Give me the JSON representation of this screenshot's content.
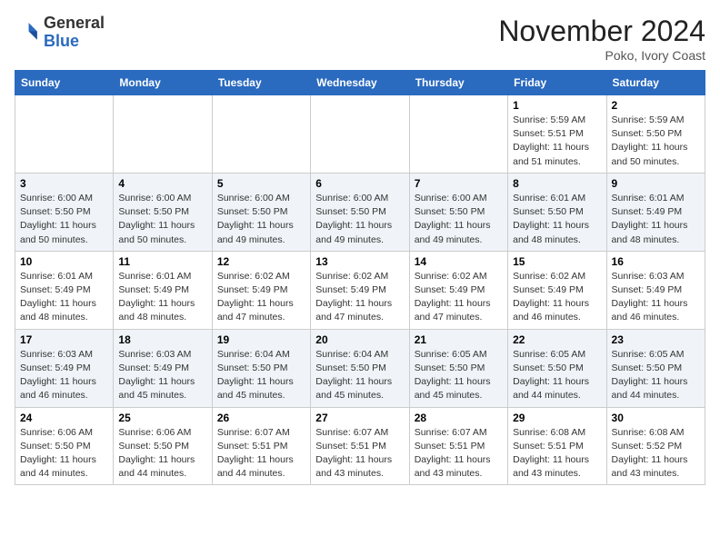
{
  "header": {
    "logo_general": "General",
    "logo_blue": "Blue",
    "month_title": "November 2024",
    "location": "Poko, Ivory Coast"
  },
  "weekdays": [
    "Sunday",
    "Monday",
    "Tuesday",
    "Wednesday",
    "Thursday",
    "Friday",
    "Saturday"
  ],
  "weeks": [
    [
      {
        "day": "",
        "info": ""
      },
      {
        "day": "",
        "info": ""
      },
      {
        "day": "",
        "info": ""
      },
      {
        "day": "",
        "info": ""
      },
      {
        "day": "",
        "info": ""
      },
      {
        "day": "1",
        "info": "Sunrise: 5:59 AM\nSunset: 5:51 PM\nDaylight: 11 hours\nand 51 minutes."
      },
      {
        "day": "2",
        "info": "Sunrise: 5:59 AM\nSunset: 5:50 PM\nDaylight: 11 hours\nand 50 minutes."
      }
    ],
    [
      {
        "day": "3",
        "info": "Sunrise: 6:00 AM\nSunset: 5:50 PM\nDaylight: 11 hours\nand 50 minutes."
      },
      {
        "day": "4",
        "info": "Sunrise: 6:00 AM\nSunset: 5:50 PM\nDaylight: 11 hours\nand 50 minutes."
      },
      {
        "day": "5",
        "info": "Sunrise: 6:00 AM\nSunset: 5:50 PM\nDaylight: 11 hours\nand 49 minutes."
      },
      {
        "day": "6",
        "info": "Sunrise: 6:00 AM\nSunset: 5:50 PM\nDaylight: 11 hours\nand 49 minutes."
      },
      {
        "day": "7",
        "info": "Sunrise: 6:00 AM\nSunset: 5:50 PM\nDaylight: 11 hours\nand 49 minutes."
      },
      {
        "day": "8",
        "info": "Sunrise: 6:01 AM\nSunset: 5:50 PM\nDaylight: 11 hours\nand 48 minutes."
      },
      {
        "day": "9",
        "info": "Sunrise: 6:01 AM\nSunset: 5:49 PM\nDaylight: 11 hours\nand 48 minutes."
      }
    ],
    [
      {
        "day": "10",
        "info": "Sunrise: 6:01 AM\nSunset: 5:49 PM\nDaylight: 11 hours\nand 48 minutes."
      },
      {
        "day": "11",
        "info": "Sunrise: 6:01 AM\nSunset: 5:49 PM\nDaylight: 11 hours\nand 48 minutes."
      },
      {
        "day": "12",
        "info": "Sunrise: 6:02 AM\nSunset: 5:49 PM\nDaylight: 11 hours\nand 47 minutes."
      },
      {
        "day": "13",
        "info": "Sunrise: 6:02 AM\nSunset: 5:49 PM\nDaylight: 11 hours\nand 47 minutes."
      },
      {
        "day": "14",
        "info": "Sunrise: 6:02 AM\nSunset: 5:49 PM\nDaylight: 11 hours\nand 47 minutes."
      },
      {
        "day": "15",
        "info": "Sunrise: 6:02 AM\nSunset: 5:49 PM\nDaylight: 11 hours\nand 46 minutes."
      },
      {
        "day": "16",
        "info": "Sunrise: 6:03 AM\nSunset: 5:49 PM\nDaylight: 11 hours\nand 46 minutes."
      }
    ],
    [
      {
        "day": "17",
        "info": "Sunrise: 6:03 AM\nSunset: 5:49 PM\nDaylight: 11 hours\nand 46 minutes."
      },
      {
        "day": "18",
        "info": "Sunrise: 6:03 AM\nSunset: 5:49 PM\nDaylight: 11 hours\nand 45 minutes."
      },
      {
        "day": "19",
        "info": "Sunrise: 6:04 AM\nSunset: 5:50 PM\nDaylight: 11 hours\nand 45 minutes."
      },
      {
        "day": "20",
        "info": "Sunrise: 6:04 AM\nSunset: 5:50 PM\nDaylight: 11 hours\nand 45 minutes."
      },
      {
        "day": "21",
        "info": "Sunrise: 6:05 AM\nSunset: 5:50 PM\nDaylight: 11 hours\nand 45 minutes."
      },
      {
        "day": "22",
        "info": "Sunrise: 6:05 AM\nSunset: 5:50 PM\nDaylight: 11 hours\nand 44 minutes."
      },
      {
        "day": "23",
        "info": "Sunrise: 6:05 AM\nSunset: 5:50 PM\nDaylight: 11 hours\nand 44 minutes."
      }
    ],
    [
      {
        "day": "24",
        "info": "Sunrise: 6:06 AM\nSunset: 5:50 PM\nDaylight: 11 hours\nand 44 minutes."
      },
      {
        "day": "25",
        "info": "Sunrise: 6:06 AM\nSunset: 5:50 PM\nDaylight: 11 hours\nand 44 minutes."
      },
      {
        "day": "26",
        "info": "Sunrise: 6:07 AM\nSunset: 5:51 PM\nDaylight: 11 hours\nand 44 minutes."
      },
      {
        "day": "27",
        "info": "Sunrise: 6:07 AM\nSunset: 5:51 PM\nDaylight: 11 hours\nand 43 minutes."
      },
      {
        "day": "28",
        "info": "Sunrise: 6:07 AM\nSunset: 5:51 PM\nDaylight: 11 hours\nand 43 minutes."
      },
      {
        "day": "29",
        "info": "Sunrise: 6:08 AM\nSunset: 5:51 PM\nDaylight: 11 hours\nand 43 minutes."
      },
      {
        "day": "30",
        "info": "Sunrise: 6:08 AM\nSunset: 5:52 PM\nDaylight: 11 hours\nand 43 minutes."
      }
    ]
  ]
}
